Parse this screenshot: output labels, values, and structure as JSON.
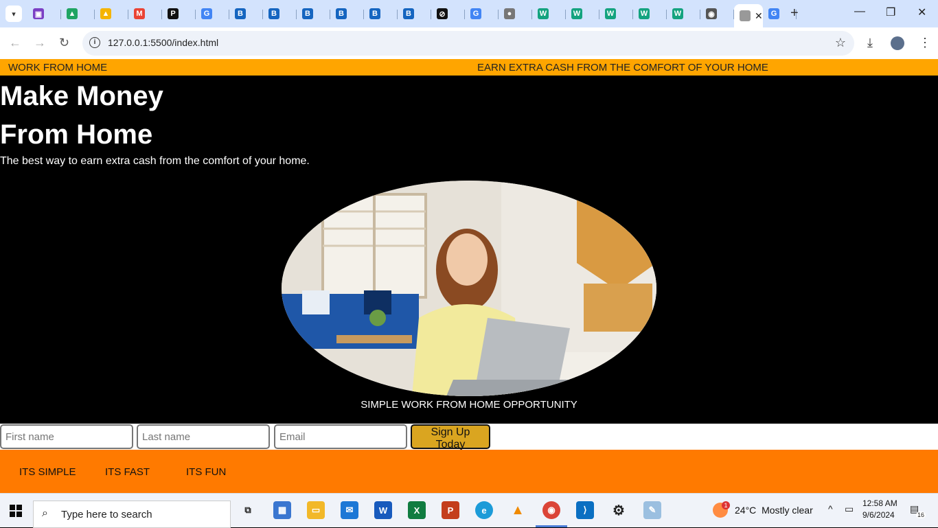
{
  "browser": {
    "url": "127.0.0.1:5500/index.html",
    "tabs": [
      {
        "icon": "contacts-icon",
        "color": "#7b3fc4",
        "glyph": "▣"
      },
      {
        "icon": "google-drive-icon",
        "color": "#1fa463",
        "glyph": "▲"
      },
      {
        "icon": "google-drive-icon",
        "color": "#f5b400",
        "glyph": "▲"
      },
      {
        "icon": "gmail-icon",
        "color": "#ea4335",
        "glyph": "M"
      },
      {
        "icon": "p-app-icon",
        "color": "#111111",
        "glyph": "P"
      },
      {
        "icon": "google-icon",
        "color": "#4285f4",
        "glyph": "G"
      },
      {
        "icon": "b-app-icon",
        "color": "#1565c0",
        "glyph": "B"
      },
      {
        "icon": "b-app-icon",
        "color": "#1565c0",
        "glyph": "B"
      },
      {
        "icon": "b-app-icon",
        "color": "#1565c0",
        "glyph": "B"
      },
      {
        "icon": "b-app-icon",
        "color": "#1565c0",
        "glyph": "B"
      },
      {
        "icon": "b-app-icon",
        "color": "#1565c0",
        "glyph": "B"
      },
      {
        "icon": "b-app-icon",
        "color": "#1565c0",
        "glyph": "B"
      },
      {
        "icon": "openai-icon",
        "color": "#111111",
        "glyph": "⊘"
      },
      {
        "icon": "google-icon",
        "color": "#4285f4",
        "glyph": "G"
      },
      {
        "icon": "globe-icon",
        "color": "#777777",
        "glyph": "●"
      },
      {
        "icon": "w-app-icon",
        "color": "#14a37f",
        "glyph": "W"
      },
      {
        "icon": "w-app-icon",
        "color": "#14a37f",
        "glyph": "W"
      },
      {
        "icon": "w-app-icon",
        "color": "#14a37f",
        "glyph": "W"
      },
      {
        "icon": "w-app-icon",
        "color": "#14a37f",
        "glyph": "W"
      },
      {
        "icon": "w-app-icon",
        "color": "#14a37f",
        "glyph": "W"
      },
      {
        "icon": "chrome-icon",
        "color": "#555555",
        "glyph": "◉"
      },
      {
        "icon": "blank-page-icon",
        "color": "#999999",
        "glyph": "",
        "active": true
      },
      {
        "icon": "google-icon",
        "color": "#4285f4",
        "glyph": "G"
      }
    ]
  },
  "page": {
    "topbar_left": "WORK FROM HOME",
    "topbar_right": "EARN EXTRA CASH FROM THE COMFORT OF YOUR HOME",
    "hero_title_line1": "Make Money",
    "hero_title_line2": "From Home",
    "hero_subtitle": "The best way to earn extra cash from the comfort of your home.",
    "photo_caption": "SIMPLE WORK FROM HOME OPPORTUNITY",
    "form": {
      "first_name_placeholder": "First name",
      "last_name_placeholder": "Last name",
      "email_placeholder": "Email",
      "submit_label": "Sign Up Today"
    },
    "features": [
      "ITS SIMPLE",
      "ITS FAST",
      "ITS FUN"
    ],
    "colors": {
      "topbar": "#ffa500",
      "button": "#daa520",
      "features_bar": "#ff7a00"
    }
  },
  "taskbar": {
    "search_placeholder": "Type here to search",
    "weather_temp": "24°C",
    "weather_desc": "Mostly clear",
    "weather_badge": "1",
    "time": "12:58 AM",
    "date": "9/6/2024",
    "notification_count": "16"
  }
}
